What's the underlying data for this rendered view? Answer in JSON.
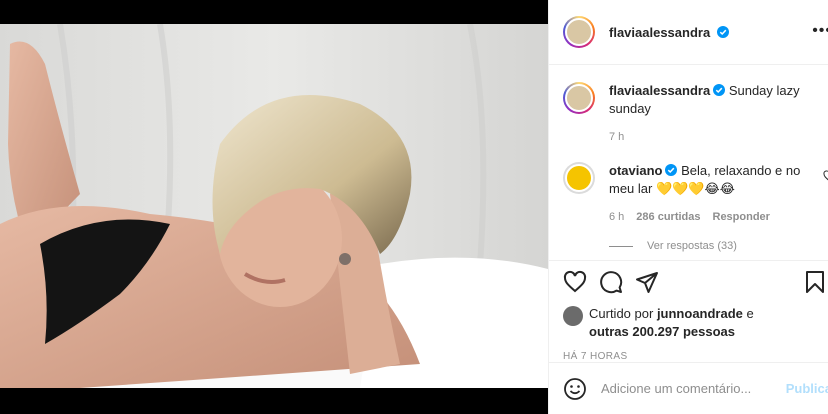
{
  "post": {
    "author": "flaviaalessandra",
    "caption": "Sunday lazy sunday",
    "caption_time": "7 h",
    "time_ago": "HÁ 7 HORAS"
  },
  "comment": {
    "user": "otaviano",
    "text": "Bela, relaxando e no meu lar 💛💛💛😂😂",
    "time": "6 h",
    "likes": "286 curtidas",
    "reply_label": "Responder",
    "view_replies": "Ver respostas (33)"
  },
  "likes": {
    "prefix": "Curtido por",
    "user": "junnoandrade",
    "conjunction": "e",
    "others": "outras 200.297 pessoas"
  },
  "add_comment": {
    "placeholder": "Adicione um comentário...",
    "publish": "Publicar"
  },
  "icons": {
    "verified": "verified-badge-icon",
    "like": "heart-icon",
    "comment": "comment-bubble-icon",
    "share": "paper-plane-icon",
    "save": "bookmark-icon",
    "emoji": "smiley-icon",
    "more": "more-options-icon"
  },
  "colors": {
    "verified_blue": "#0095f6",
    "muted_text": "#8e8e8e",
    "publish_disabled": "#b2dffc"
  }
}
